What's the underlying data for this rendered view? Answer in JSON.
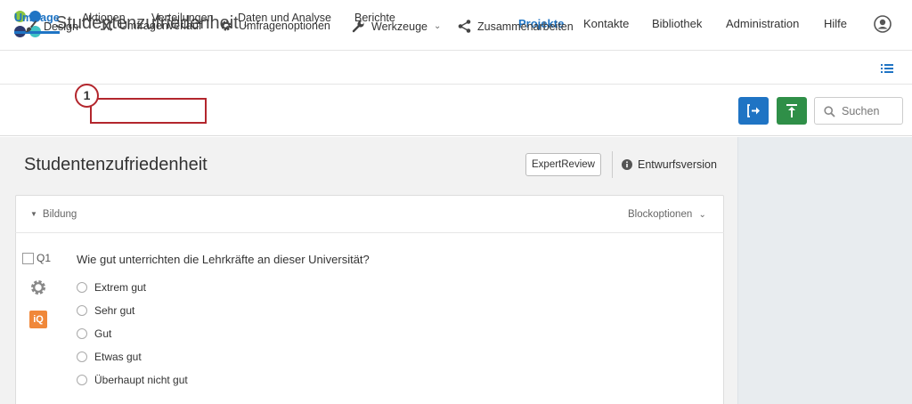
{
  "header": {
    "logo_colors": [
      "#8cc63f",
      "#1f74c4",
      "#2e3a6e",
      "#40c4c4"
    ],
    "project_title": "Studentenzufriedenheit",
    "nav": [
      "Projekte",
      "Kontakte",
      "Bibliothek",
      "Administration",
      "Hilfe"
    ],
    "active_nav": "Projekte",
    "user_icon": "user-circle-icon"
  },
  "subnav": {
    "tabs": [
      "Umfrage",
      "Aktionen",
      "Verteilungen",
      "Daten und Analyse",
      "Berichte"
    ],
    "active_tab": "Umfrage",
    "list_icon": "list-icon"
  },
  "toolbar": {
    "design": "Design",
    "survey_flow": "Umfragenverlauf",
    "survey_options": "Umfragenoptionen",
    "tools": "Werkzeuge",
    "collaborate": "Zusammenarbeiten",
    "step_badge": "1",
    "search_placeholder": "Suchen",
    "accent_blue": "#1f74c4",
    "accent_green": "#2f8f48",
    "highlight_color": "#b3262d"
  },
  "survey": {
    "title": "Studentenzufriedenheit",
    "expert_review": "ExpertReview",
    "draft_version": "Entwurfsversion"
  },
  "block": {
    "name": "Bildung",
    "options": "Blockoptionen"
  },
  "question": {
    "id": "Q1",
    "iq_badge": "iQ",
    "iq_color": "#f0883a",
    "text": "Wie gut unterrichten die Lehrkräfte an dieser Universität?",
    "choices": [
      "Extrem gut",
      "Sehr gut",
      "Gut",
      "Etwas gut",
      "Überhaupt nicht gut"
    ]
  }
}
